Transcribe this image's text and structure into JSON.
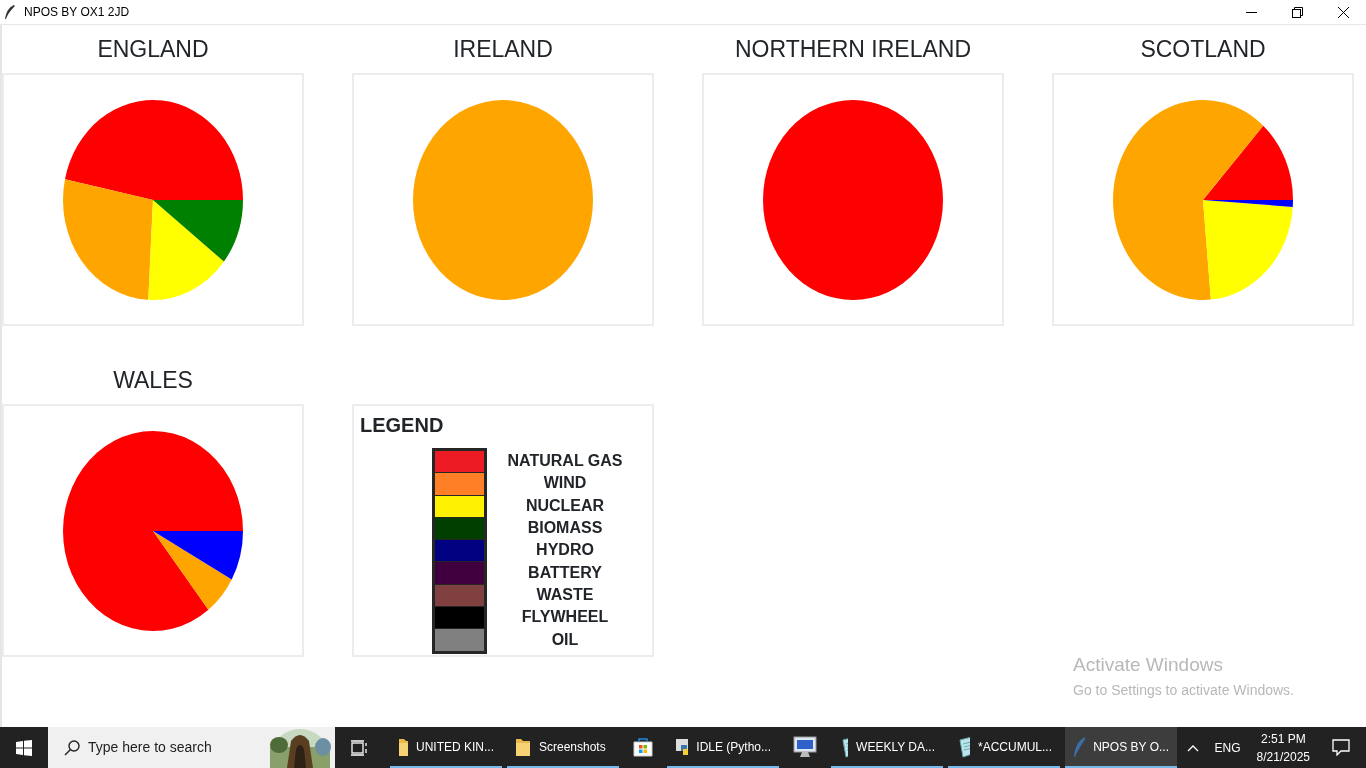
{
  "window": {
    "title": "NPOS BY OX1 2JD"
  },
  "charts": [
    {
      "title": "ENGLAND",
      "kind": "england"
    },
    {
      "title": "IRELAND",
      "kind": "ireland"
    },
    {
      "title": "NORTHERN IRELAND",
      "kind": "northern-ireland"
    },
    {
      "title": "SCOTLAND",
      "kind": "scotland"
    },
    {
      "title": "WALES",
      "kind": "wales"
    }
  ],
  "legend": {
    "title": "LEGEND",
    "items": [
      {
        "label": "NATURAL GAS",
        "color": "#ed1c24"
      },
      {
        "label": "WIND",
        "color": "#ff7f27"
      },
      {
        "label": "NUCLEAR",
        "color": "#fff200"
      },
      {
        "label": "BIOMASS",
        "color": "#003f00"
      },
      {
        "label": "HYDRO",
        "color": "#000080"
      },
      {
        "label": "BATTERY",
        "color": "#400040"
      },
      {
        "label": "WASTE",
        "color": "#804040"
      },
      {
        "label": "FLYWHEEL",
        "color": "#000000"
      },
      {
        "label": "OIL",
        "color": "#808080"
      }
    ]
  },
  "activation_notice": {
    "heading": "Activate Windows",
    "text": "Go to Settings to activate Windows."
  },
  "taskbar": {
    "search": {
      "placeholder": "Type here to search"
    },
    "apps": [
      {
        "kind": "folder",
        "label": "UNITED KIN...",
        "open": true,
        "selected": false
      },
      {
        "kind": "folder",
        "label": "Screenshots",
        "open": true,
        "selected": false
      },
      {
        "kind": "store",
        "open": false,
        "selected": false
      },
      {
        "kind": "python",
        "label": "IDLE (Pytho...",
        "open": true,
        "selected": false
      },
      {
        "kind": "monitor",
        "open": false,
        "selected": false
      },
      {
        "kind": "notepad",
        "label": "WEEKLY DA...",
        "open": true,
        "selected": false
      },
      {
        "kind": "notepad",
        "label": "*ACCUMUL...",
        "open": true,
        "selected": false
      },
      {
        "kind": "feather",
        "label": "NPOS BY O...",
        "open": true,
        "selected": true
      }
    ],
    "tray": {
      "language": "ENG",
      "time": "2:51 PM",
      "date": "8/21/2025"
    }
  }
}
